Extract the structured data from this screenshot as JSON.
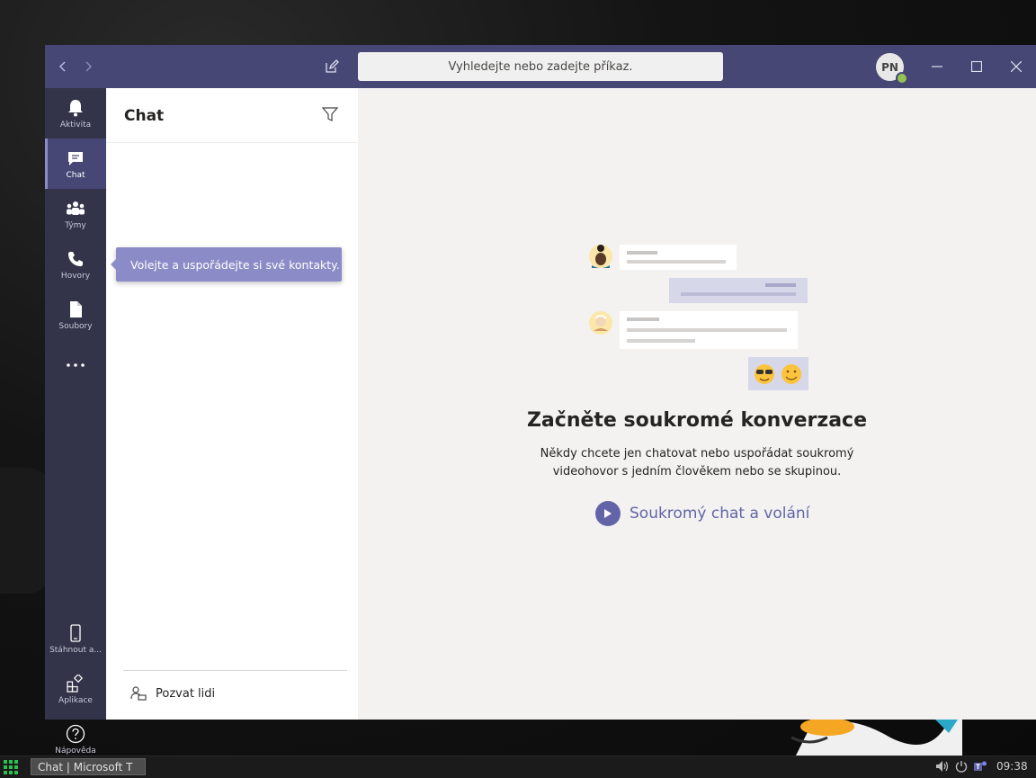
{
  "titlebar": {
    "search_placeholder": "Vyhledejte nebo zadejte příkaz.",
    "avatar_initials": "PN"
  },
  "rail": {
    "items": [
      {
        "label": "Aktivita",
        "icon": "bell-icon"
      },
      {
        "label": "Chat",
        "icon": "chat-icon",
        "active": true
      },
      {
        "label": "Týmy",
        "icon": "teams-icon"
      },
      {
        "label": "Hovory",
        "icon": "phone-icon"
      },
      {
        "label": "Soubory",
        "icon": "file-icon"
      }
    ],
    "more_icon": "ellipsis-icon",
    "bottom_items": [
      {
        "label": "Stáhnout a...",
        "icon": "mobile-icon"
      },
      {
        "label": "Aplikace",
        "icon": "apps-icon"
      },
      {
        "label": "Nápověda",
        "icon": "help-icon"
      }
    ]
  },
  "panel": {
    "title": "Chat",
    "tooltip": "Volejte a uspořádejte si své kontakty.",
    "invite_label": "Pozvat lidi"
  },
  "main": {
    "headline": "Začněte soukromé konverzace",
    "subtext": "Někdy chcete jen chatovat nebo uspořádat soukromý videohovor s jedním člověkem nebo se skupinou.",
    "cta_label": "Soukromý chat a volání"
  },
  "taskbar": {
    "task_label": "Chat | Microsoft T",
    "clock": "09:38"
  },
  "colors": {
    "titlebar": "#464775",
    "rail": "#33344a",
    "accent": "#6264a7",
    "tooltip": "#8b8cc7"
  }
}
